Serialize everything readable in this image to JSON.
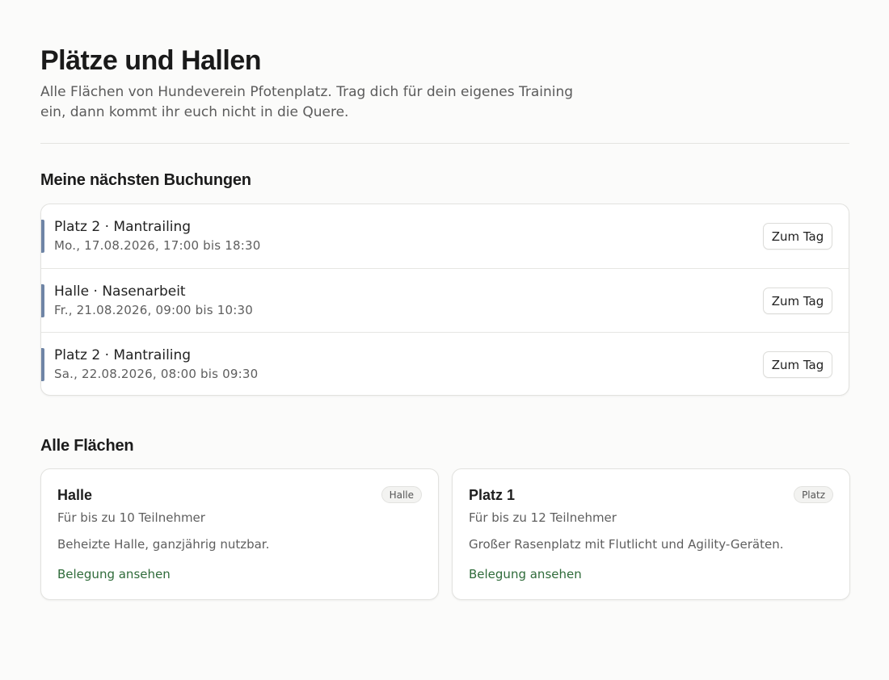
{
  "header": {
    "title": "Plätze und Hallen",
    "intro": "Alle Flächen von Hundeverein Pfotenplatz. Trag dich für dein eigenes Training ein, dann kommt ihr euch nicht in die Quere."
  },
  "bookings": {
    "title": "Meine nächsten Buchungen",
    "button_label": "Zum Tag",
    "accent_color": "#6f85a6",
    "items": [
      {
        "title": "Platz 2 · Mantrailing",
        "time": "Mo., 17.08.2026, 17:00 bis 18:30"
      },
      {
        "title": "Halle · Nasenarbeit",
        "time": "Fr., 21.08.2026, 09:00 bis 10:30"
      },
      {
        "title": "Platz 2 · Mantrailing",
        "time": "Sa., 22.08.2026, 08:00 bis 09:30"
      }
    ]
  },
  "areas": {
    "title": "Alle Flächen",
    "link_color": "#2f6b3a",
    "items": [
      {
        "name": "Halle",
        "badge": "Halle",
        "capacity": "Für bis zu 10 Teilnehmer",
        "description": "Beheizte Halle, ganzjährig nutzbar.",
        "link": "Belegung ansehen"
      },
      {
        "name": "Platz 1",
        "badge": "Platz",
        "capacity": "Für bis zu 12 Teilnehmer",
        "description": "Großer Rasenplatz mit Flutlicht und Agility-Geräten.",
        "link": "Belegung ansehen"
      }
    ]
  }
}
